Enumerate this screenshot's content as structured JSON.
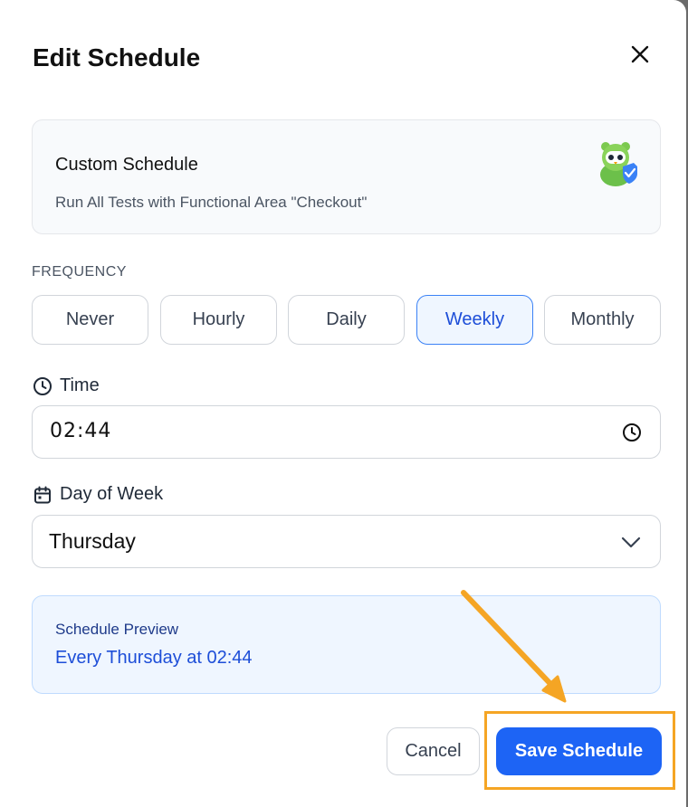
{
  "dialog": {
    "title": "Edit Schedule"
  },
  "schedule_card": {
    "title": "Custom Schedule",
    "description": "Run All Tests with Functional Area \"Checkout\""
  },
  "frequency": {
    "label": "FREQUENCY",
    "options": [
      "Never",
      "Hourly",
      "Daily",
      "Weekly",
      "Monthly"
    ],
    "selected": "Weekly"
  },
  "time": {
    "label": "Time",
    "value": "02:44"
  },
  "day_of_week": {
    "label": "Day of Week",
    "value": "Thursday"
  },
  "preview": {
    "title": "Schedule Preview",
    "text": "Every Thursday at 02:44"
  },
  "footer": {
    "cancel_label": "Cancel",
    "save_label": "Save Schedule"
  },
  "colors": {
    "accent": "#1d64f5",
    "highlight": "#f5a524",
    "selected_bg": "#eff6ff"
  },
  "icons": [
    "close-icon",
    "app-logo-icon",
    "clock-icon",
    "calendar-icon",
    "chevron-down-icon"
  ]
}
